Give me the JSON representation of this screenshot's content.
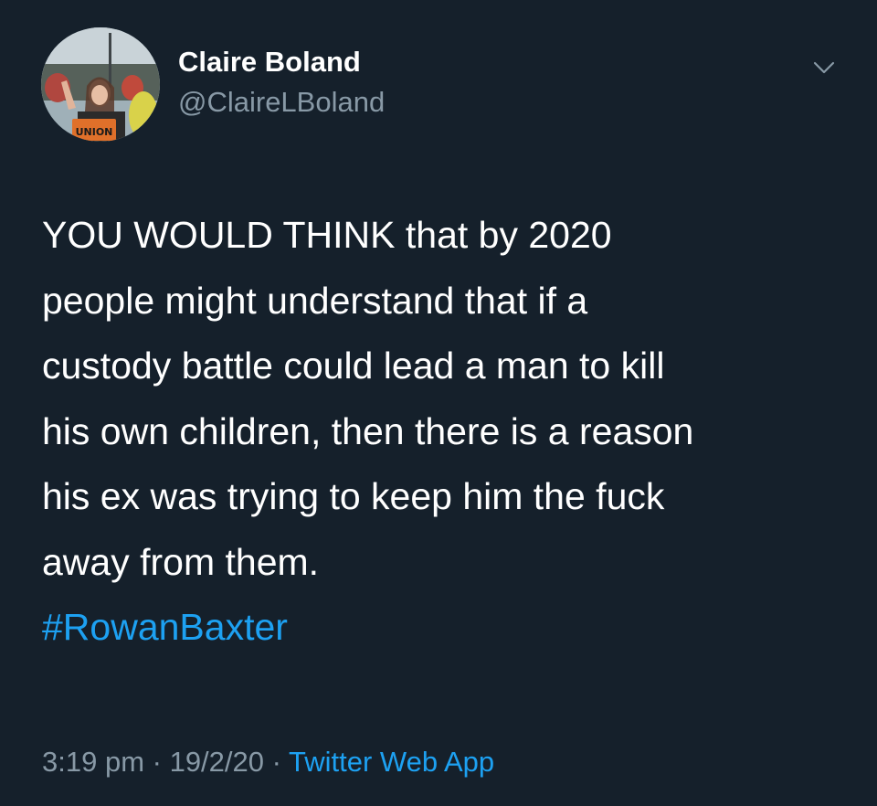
{
  "user": {
    "display_name": "Claire Boland",
    "handle": "@ClaireLBoland",
    "avatar_sign_text": "UNION"
  },
  "tweet": {
    "lines": [
      "YOU WOULD THINK that by 2020",
      "people might understand that if a",
      "custody battle could lead a man to kill",
      "his own children, then there is a reason",
      "his ex was trying to keep him the fuck",
      "away from them."
    ],
    "hashtag": "#RowanBaxter"
  },
  "meta": {
    "time": "3:19 pm",
    "separator": " · ",
    "date": "19/2/20",
    "source": "Twitter Web App"
  },
  "icons": {
    "menu": "chevron-down-icon"
  },
  "colors": {
    "background": "#15202b",
    "text": "#ffffff",
    "secondary": "#8899a6",
    "accent": "#1da1f2"
  }
}
